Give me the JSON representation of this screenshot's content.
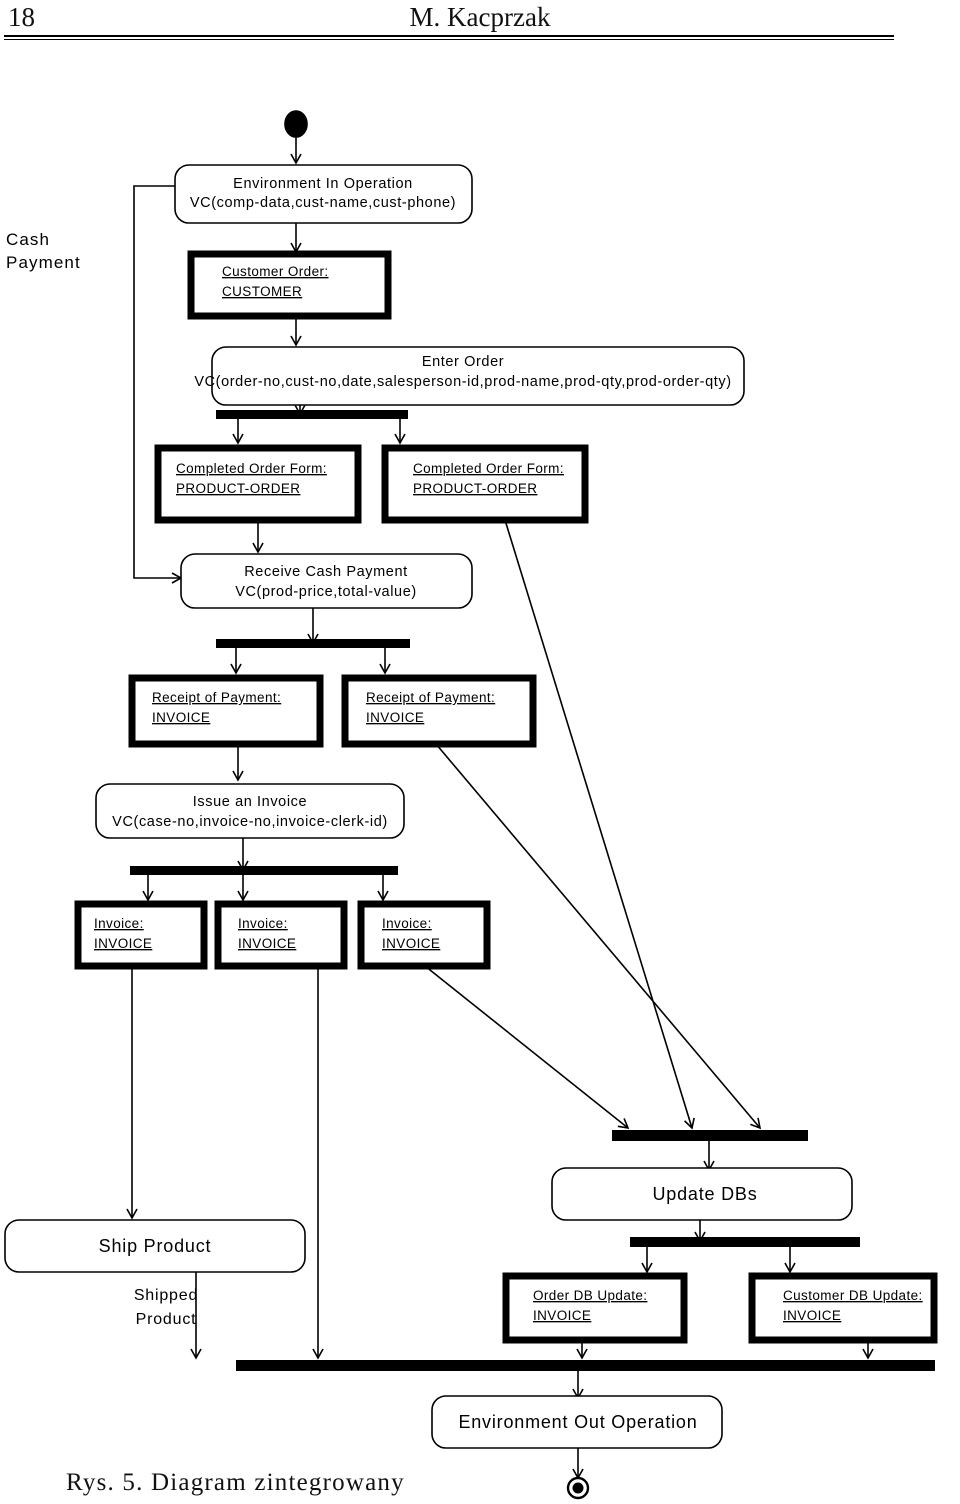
{
  "page": {
    "number": "18",
    "running_head": "M. Kacprzak",
    "caption": "Rys. 5. Diagram zintegrowany"
  },
  "swimlane": {
    "label_line1": "Cash",
    "label_line2": "Payment"
  },
  "diagram": {
    "type": "uml-activity-diagram",
    "title": "Diagram zintegrowany",
    "start_node": "filled-circle",
    "end_node": "bullseye-circle",
    "activities": [
      {
        "id": "env-in",
        "line1": "Environment In Operation",
        "line2": "VC(comp-data,cust-name,cust-phone)"
      },
      {
        "id": "enter-order",
        "line1": "Enter Order",
        "line2": "VC(order-no,cust-no,date,salesperson-id,prod-name,prod-qty,prod-order-qty)"
      },
      {
        "id": "receive-cash",
        "line1": "Receive Cash Payment",
        "line2": "VC(prod-price,total-value)"
      },
      {
        "id": "issue-invoice",
        "line1": "Issue an Invoice",
        "line2": "VC(case-no,invoice-no,invoice-clerk-id)"
      },
      {
        "id": "ship-product",
        "line1": "Ship Product",
        "line2": ""
      },
      {
        "id": "update-dbs",
        "line1": "Update DBs",
        "line2": ""
      },
      {
        "id": "env-out",
        "line1": "Environment Out Operation",
        "line2": ""
      }
    ],
    "object_nodes": [
      {
        "id": "customer-order",
        "name": "Customer Order:",
        "classifier": "CUSTOMER"
      },
      {
        "id": "order-form-1",
        "name": "Completed Order Form:",
        "classifier": "PRODUCT-ORDER"
      },
      {
        "id": "order-form-2",
        "name": "Completed Order Form:",
        "classifier": "PRODUCT-ORDER"
      },
      {
        "id": "receipt-1",
        "name": "Receipt of Payment:",
        "classifier": "INVOICE"
      },
      {
        "id": "receipt-2",
        "name": "Receipt of Payment:",
        "classifier": "INVOICE"
      },
      {
        "id": "invoice-1",
        "name": "Invoice:",
        "classifier": "INVOICE"
      },
      {
        "id": "invoice-2",
        "name": "Invoice:",
        "classifier": "INVOICE"
      },
      {
        "id": "invoice-3",
        "name": "Invoice:",
        "classifier": "INVOICE"
      },
      {
        "id": "order-db",
        "name": "Order DB Update:",
        "classifier": "INVOICE"
      },
      {
        "id": "customer-db",
        "name": "Customer DB Update:",
        "classifier": "INVOICE"
      }
    ],
    "flow_labels": [
      {
        "id": "shipped-product",
        "line1": "Shipped",
        "line2": "Product"
      }
    ],
    "bars": [
      {
        "id": "fork-after-enter-order"
      },
      {
        "id": "fork-after-receive-cash"
      },
      {
        "id": "fork-after-issue-invoice"
      },
      {
        "id": "join-before-update-dbs"
      },
      {
        "id": "fork-after-update-dbs"
      },
      {
        "id": "join-before-env-out"
      }
    ],
    "colors": {
      "stroke": "#000000",
      "fill": "#ffffff",
      "background": "#ffffff"
    }
  }
}
